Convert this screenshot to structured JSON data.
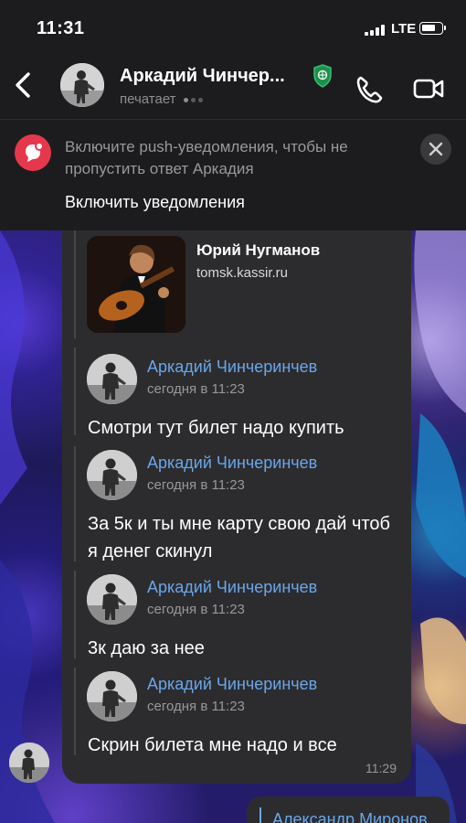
{
  "status_bar": {
    "time": "11:31",
    "network": "LTE"
  },
  "header": {
    "title": "Аркадий Чинчер...",
    "status": "печатает"
  },
  "push_banner": {
    "text": "Включите push-уведомления, чтобы не пропустить ответ Аркадия",
    "action": "Включить уведомления"
  },
  "link_preview": {
    "name": "Юрий Нугманов",
    "domain": "tomsk.kassir.ru"
  },
  "forwarded_messages": [
    {
      "author": "Аркадий Чинчеринчев",
      "date": "сегодня в 11:23",
      "text": "Смотри тут билет надо купить"
    },
    {
      "author": "Аркадий Чинчеринчев",
      "date": "сегодня в 11:23",
      "text": "За 5к и ты мне карту свою дай чтоб я денег скинул"
    },
    {
      "author": "Аркадий Чинчеринчев",
      "date": "сегодня в 11:23",
      "text": "3к даю за нее"
    },
    {
      "author": "Аркадий Чинчеринчев",
      "date": "сегодня в 11:23",
      "text": "Скрин билета мне надо и все"
    }
  ],
  "bubble_time": "11:29",
  "next_message": {
    "author": "Александр Миронов"
  },
  "colors": {
    "accent": "#6aa6ea",
    "push_icon": "#e6384d",
    "bubble": "#2c2c2e",
    "header": "#1c1c1e"
  },
  "icons": [
    "back-chevron-icon",
    "verified-shield-icon",
    "phone-call-icon",
    "video-call-icon",
    "notification-icon",
    "close-icon"
  ]
}
